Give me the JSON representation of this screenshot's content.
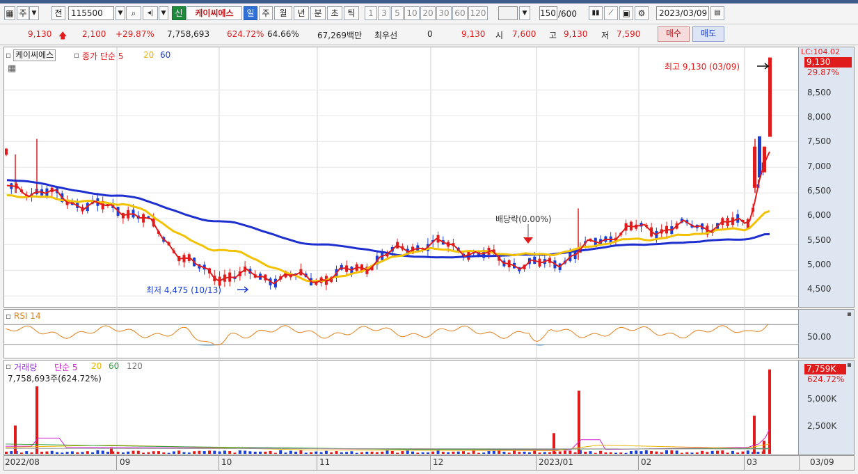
{
  "toolbar": {
    "market": "주",
    "period_label": "전",
    "code": "115500",
    "new_badge": "신",
    "stock_name": "케이씨에스",
    "periods": [
      "일",
      "주",
      "월",
      "년",
      "분",
      "초",
      "틱"
    ],
    "intervals": [
      "1",
      "3",
      "5",
      "10",
      "20",
      "30",
      "60",
      "120"
    ],
    "count_value": "150",
    "count_total": "/600",
    "date": "2023/03/09"
  },
  "quote": {
    "price": "9,130",
    "change": "2,100",
    "change_pct": "+29.87%",
    "volume": "7,758,693",
    "volume_pct": "624.72%",
    "ratio": "64.66%",
    "amount": "67,269백만",
    "best_label": "최우선",
    "best_qty": "0",
    "best_price": "9,130",
    "open_label": "시",
    "open": "7,600",
    "high_label": "고",
    "high": "9,130",
    "low_label": "저",
    "low": "7,590",
    "buy_button": "매수",
    "sell_button": "매도"
  },
  "price_panel": {
    "name": "케이씨에스",
    "ma_label": "종가 단순 5",
    "ma_20": "20",
    "ma_60": "60",
    "high_note": "최고 9,130 (03/09)",
    "low_note": "최저 4,475 (10/13)",
    "dividend_note": "배당락(0.00%)",
    "scale_top": "LC:104.02",
    "current_badge": "9,130",
    "current_pct": "29.87%",
    "ticks": [
      "8,500",
      "8,000",
      "7,500",
      "7,000",
      "6,500",
      "6,000",
      "5,500",
      "5,000",
      "4,500"
    ]
  },
  "rsi_panel": {
    "label": "RSI 14",
    "tick": "50.00"
  },
  "volume_panel": {
    "label": "거래량",
    "ma_label": "단순 5",
    "ma_20": "20",
    "ma_60": "60",
    "ma_120": "120",
    "info": "7,758,693주(624.72%)",
    "current_badge": "7,759K",
    "current_pct": "624.72%",
    "ticks": [
      "5,000K",
      "2,500K"
    ]
  },
  "x_axis": {
    "labels": [
      "2022/08",
      "09",
      "10",
      "11",
      "12",
      "2023/01",
      "02",
      "03"
    ],
    "right_label": "03/09"
  },
  "colors": {
    "up": "#e01b1b",
    "down": "#1a3fd6",
    "ma5": "#e01b1b",
    "ma20": "#f2c200",
    "ma60": "#1e2fd0"
  },
  "chart_data": {
    "type": "candlestick",
    "series": [
      {
        "name": "종가 단순 5",
        "x": [
          "2022/08",
          "09",
          "10",
          "11",
          "12",
          "2023/01",
          "02",
          "03",
          "03/09"
        ],
        "values": [
          6600,
          6200,
          4900,
          4850,
          5500,
          5100,
          5800,
          5900,
          7300
        ]
      },
      {
        "name": "20",
        "x": [
          "2022/08",
          "09",
          "10",
          "11",
          "12",
          "2023/01",
          "02",
          "03",
          "03/09"
        ],
        "values": [
          6450,
          6300,
          5400,
          4800,
          5400,
          5300,
          5600,
          5800,
          6150
        ]
      },
      {
        "name": "60",
        "x": [
          "2022/08",
          "09",
          "10",
          "11",
          "12",
          "2023/01",
          "02",
          "03",
          "03/09"
        ],
        "values": [
          6750,
          6450,
          5950,
          5500,
          5250,
          5300,
          5500,
          5600,
          5700
        ]
      }
    ],
    "ylim": [
      4300,
      9300
    ],
    "rsi": {
      "label": "RSI 14",
      "reference": 50
    },
    "volume_max": "7,759K"
  }
}
